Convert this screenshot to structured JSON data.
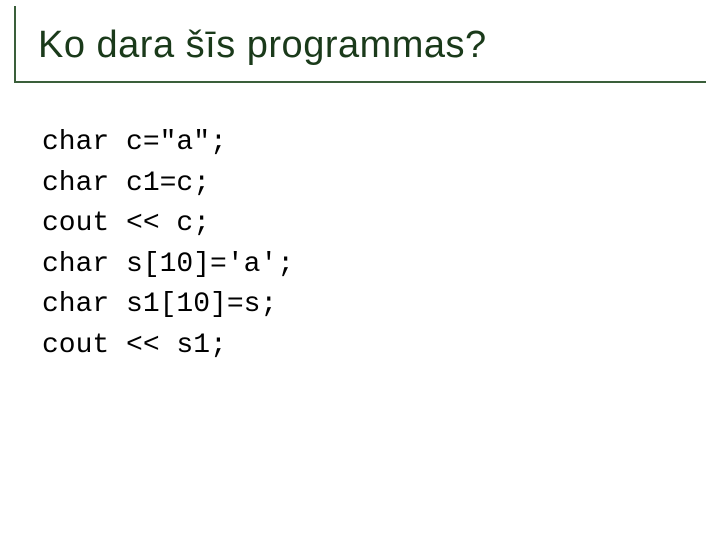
{
  "title": "Ko dara šīs programmas?",
  "code": {
    "line1": "char c=\"a\";",
    "line2": "char c1=c;",
    "line3": "cout << c;",
    "line4": "char s[10]='a';",
    "line5": "char s1[10]=s;",
    "line6": "cout << s1;"
  }
}
